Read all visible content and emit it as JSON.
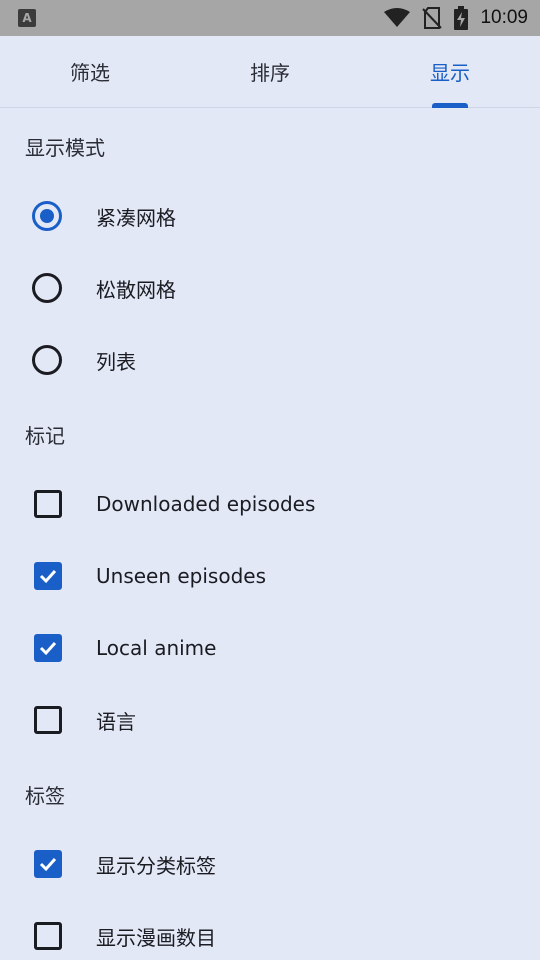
{
  "status_bar": {
    "app_icon_letter": "A",
    "time": "10:09",
    "icons": [
      "wifi-icon",
      "no-sim-icon",
      "battery-charging-icon"
    ]
  },
  "tabs": [
    {
      "label": "筛选",
      "active": false
    },
    {
      "label": "排序",
      "active": false
    },
    {
      "label": "显示",
      "active": true
    }
  ],
  "display_mode": {
    "title": "显示模式",
    "options": [
      {
        "label": "紧凑网格",
        "selected": true
      },
      {
        "label": "松散网格",
        "selected": false
      },
      {
        "label": "列表",
        "selected": false
      }
    ]
  },
  "badges": {
    "title": "标记",
    "options": [
      {
        "label": "Downloaded episodes",
        "checked": false
      },
      {
        "label": "Unseen episodes",
        "checked": true
      },
      {
        "label": "Local anime",
        "checked": true
      },
      {
        "label": "语言",
        "checked": false
      }
    ]
  },
  "tags": {
    "title": "标签",
    "options": [
      {
        "label": "显示分类标签",
        "checked": true
      },
      {
        "label": "显示漫画数目",
        "checked": false
      }
    ]
  },
  "colors": {
    "accent": "#1a5fc7",
    "background": "#e3e8f7",
    "status_bar": "#a6a6a6"
  }
}
